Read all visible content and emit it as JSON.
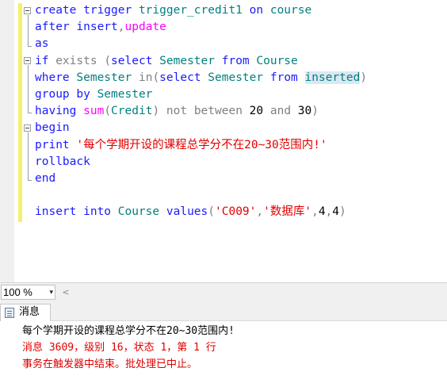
{
  "editor": {
    "lines": [
      [
        {
          "t": "create trigger ",
          "c": "kw"
        },
        {
          "t": "trigger_credit1 ",
          "c": "ob"
        },
        {
          "t": "on ",
          "c": "kw"
        },
        {
          "t": "course",
          "c": "ob"
        }
      ],
      [
        {
          "t": "after insert",
          "c": "kw"
        },
        {
          "t": ",",
          "c": "gy"
        },
        {
          "t": "update",
          "c": "fn"
        }
      ],
      [
        {
          "t": "as",
          "c": "kw"
        }
      ],
      [
        {
          "t": "if ",
          "c": "kw"
        },
        {
          "t": "exists ",
          "c": "gy"
        },
        {
          "t": "(",
          "c": "gy"
        },
        {
          "t": "select ",
          "c": "kw"
        },
        {
          "t": "Semester ",
          "c": "ob"
        },
        {
          "t": "from ",
          "c": "kw"
        },
        {
          "t": "Course",
          "c": "ob"
        }
      ],
      [
        {
          "t": "where ",
          "c": "kw"
        },
        {
          "t": "Semester ",
          "c": "ob"
        },
        {
          "t": "in",
          "c": "gy"
        },
        {
          "t": "(",
          "c": "gy"
        },
        {
          "t": "select ",
          "c": "kw"
        },
        {
          "t": "Semester ",
          "c": "ob"
        },
        {
          "t": "from ",
          "c": "kw"
        },
        {
          "t": "inserted",
          "c": "ob hl"
        },
        {
          "t": ")",
          "c": "gy"
        }
      ],
      [
        {
          "t": "group by ",
          "c": "kw"
        },
        {
          "t": "Semester",
          "c": "ob"
        }
      ],
      [
        {
          "t": "having ",
          "c": "kw"
        },
        {
          "t": "sum",
          "c": "fn"
        },
        {
          "t": "(",
          "c": "gy"
        },
        {
          "t": "Credit",
          "c": "ob"
        },
        {
          "t": ") ",
          "c": "gy"
        },
        {
          "t": "not between ",
          "c": "gy"
        },
        {
          "t": "20 ",
          "c": ""
        },
        {
          "t": "and ",
          "c": "gy"
        },
        {
          "t": "30",
          "c": ""
        },
        {
          "t": ")",
          "c": "gy"
        }
      ],
      [
        {
          "t": "begin",
          "c": "kw"
        }
      ],
      [
        {
          "t": "print ",
          "c": "kw"
        },
        {
          "t": "'每个学期开设的课程总学分不在20~30范围内!'",
          "c": "st"
        }
      ],
      [
        {
          "t": "rollback",
          "c": "kw"
        }
      ],
      [
        {
          "t": "end",
          "c": "kw"
        }
      ],
      [],
      [
        {
          "t": "insert into ",
          "c": "kw"
        },
        {
          "t": "Course ",
          "c": "ob"
        },
        {
          "t": "values",
          "c": "kw"
        },
        {
          "t": "(",
          "c": "gy"
        },
        {
          "t": "'C009'",
          "c": "st"
        },
        {
          "t": ",",
          "c": "gy"
        },
        {
          "t": "'数据库'",
          "c": "st"
        },
        {
          "t": ",",
          "c": "gy"
        },
        {
          "t": "4",
          "c": ""
        },
        {
          "t": ",",
          "c": "gy"
        },
        {
          "t": "4",
          "c": ""
        },
        {
          "t": ")",
          "c": "gy"
        }
      ]
    ]
  },
  "statusbar": {
    "zoom": "100 %",
    "zoom_arrow_icon": "dropdown-arrow-icon",
    "scroll_left_icon": "scroll-left-icon"
  },
  "results": {
    "tab_label": "消息",
    "tab_icon": "messages-icon",
    "messages": [
      {
        "text": "每个学期开设的课程总学分不在20~30范围内!",
        "error": false
      },
      {
        "text": "消息 3609，级别 16，状态 1，第 1 行",
        "error": true
      },
      {
        "text": "事务在触发器中结束。批处理已中止。",
        "error": true
      }
    ]
  },
  "colors": {
    "keyword": "#1a1aff",
    "function": "#ff00ff",
    "operator": "#808080",
    "object": "#008080",
    "string": "#e00000",
    "error_text": "#e00000",
    "change_bar": "#f5ef6e"
  }
}
